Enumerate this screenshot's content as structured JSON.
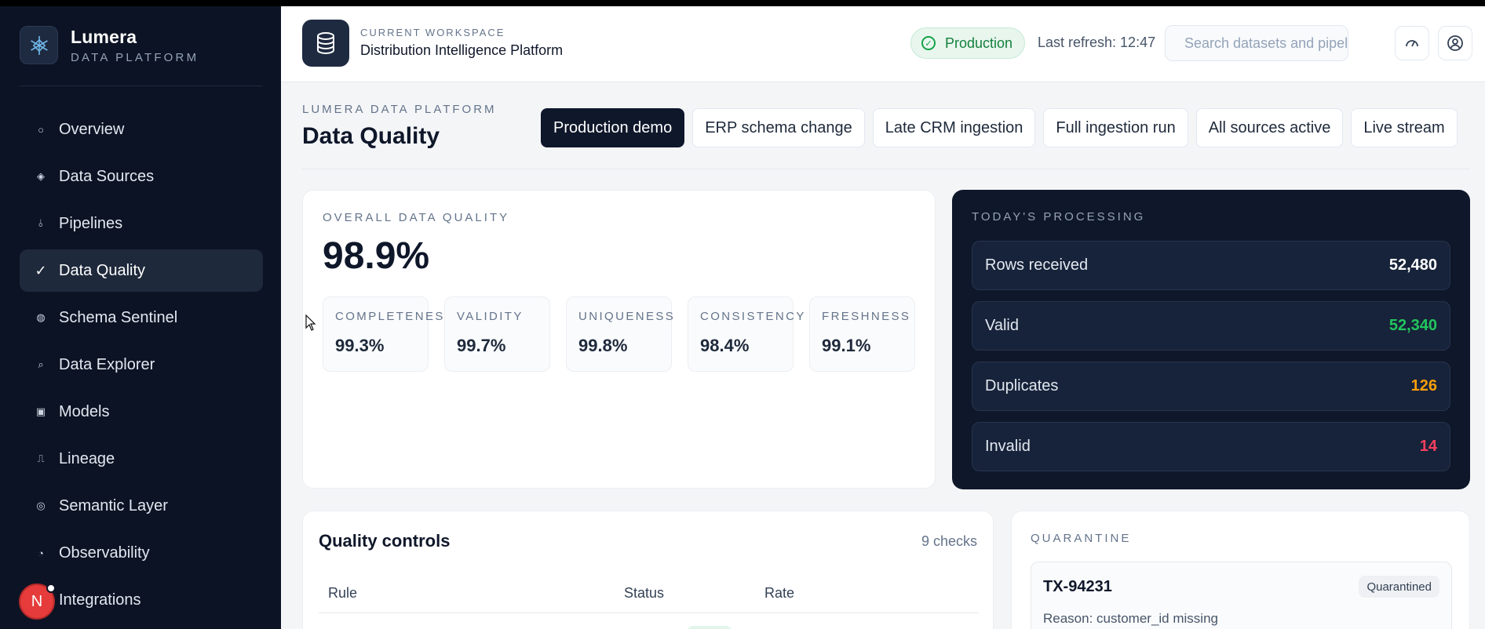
{
  "brand": {
    "name": "Lumera",
    "subtitle": "DATA PLATFORM"
  },
  "sidebar": {
    "items": [
      {
        "label": "Overview",
        "icon": "circle-icon",
        "glyph": "○"
      },
      {
        "label": "Data Sources",
        "icon": "diamond-icon",
        "glyph": "◈"
      },
      {
        "label": "Pipelines",
        "icon": "pipeline-icon",
        "glyph": "⫰"
      },
      {
        "label": "Data Quality",
        "icon": "check-icon",
        "glyph": "✓",
        "active": true
      },
      {
        "label": "Schema Sentinel",
        "icon": "sentinel-icon",
        "glyph": "◍"
      },
      {
        "label": "Data Explorer",
        "icon": "search-icon",
        "glyph": "⌕"
      },
      {
        "label": "Models",
        "icon": "model-icon",
        "glyph": "▣"
      },
      {
        "label": "Lineage",
        "icon": "lineage-icon",
        "glyph": "⎍"
      },
      {
        "label": "Semantic Layer",
        "icon": "semantic-icon",
        "glyph": "◎"
      },
      {
        "label": "Observability",
        "icon": "observability-icon",
        "glyph": "◔"
      },
      {
        "label": "Integrations",
        "icon": "integrations-icon",
        "glyph": "⬡"
      }
    ],
    "avatar_initial": "N"
  },
  "header": {
    "workspace_label": "CURRENT WORKSPACE",
    "workspace_name": "Distribution Intelligence Platform",
    "environment": "Production",
    "last_refresh": "Last refresh: 12:47",
    "search_placeholder": "Search datasets and pipelines"
  },
  "page": {
    "kicker": "LUMERA DATA PLATFORM",
    "title": "Data Quality",
    "scenarios": [
      {
        "label": "Production demo",
        "active": true
      },
      {
        "label": "ERP schema change"
      },
      {
        "label": "Late CRM ingestion"
      },
      {
        "label": "Full ingestion run"
      },
      {
        "label": "All sources active"
      },
      {
        "label": "Live stream"
      }
    ]
  },
  "overall": {
    "kicker": "OVERALL DATA QUALITY",
    "value": "98.9%",
    "dimensions": [
      {
        "label": "COMPLETENESS",
        "value": "99.3%"
      },
      {
        "label": "VALIDITY",
        "value": "99.7%"
      },
      {
        "label": "UNIQUENESS",
        "value": "99.8%"
      },
      {
        "label": "CONSISTENCY",
        "value": "98.4%"
      },
      {
        "label": "FRESHNESS",
        "value": "99.1%"
      }
    ]
  },
  "processing": {
    "kicker": "TODAY'S PROCESSING",
    "rows": [
      {
        "label": "Rows received",
        "value": "52,480",
        "color": "#ffffff"
      },
      {
        "label": "Valid",
        "value": "52,340",
        "color": "#22c55e"
      },
      {
        "label": "Duplicates",
        "value": "126",
        "color": "#f59e0b"
      },
      {
        "label": "Invalid",
        "value": "14",
        "color": "#f43f5e"
      }
    ]
  },
  "quality_controls": {
    "title": "Quality controls",
    "count": "9 checks",
    "columns": [
      "Rule",
      "Status",
      "Rate"
    ]
  },
  "quarantine": {
    "kicker": "QUARANTINE",
    "item": {
      "id": "TX-94231",
      "badge": "Quarantined",
      "reason": "Reason: customer_id missing"
    }
  }
}
